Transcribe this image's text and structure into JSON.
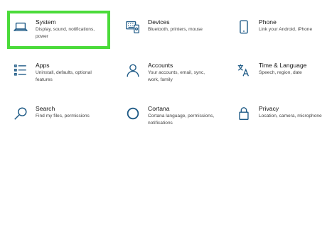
{
  "tiles": [
    {
      "icon": "laptop-icon",
      "title": "System",
      "desc": [
        "Display, sound, notifications,",
        "power"
      ]
    },
    {
      "icon": "keyboard-icon",
      "title": "Devices",
      "desc": [
        "Bluetooth, printers, mouse"
      ]
    },
    {
      "icon": "phone-icon",
      "title": "Phone",
      "desc": [
        "Link your Android, iPhone"
      ]
    },
    {
      "icon": "apps-list-icon",
      "title": "Apps",
      "desc": [
        "Uninstall, defaults, optional",
        "features"
      ]
    },
    {
      "icon": "person-icon",
      "title": "Accounts",
      "desc": [
        "Your accounts, email, sync,",
        "work, family"
      ]
    },
    {
      "icon": "language-icon",
      "title": "Time & Language",
      "desc": [
        "Speech, region, date"
      ]
    },
    {
      "icon": "search-icon",
      "title": "Search",
      "desc": [
        "Find my files, permissions"
      ]
    },
    {
      "icon": "cortana-icon",
      "title": "Cortana",
      "desc": [
        "Cortana language, permissions,",
        "notifications"
      ]
    },
    {
      "icon": "lock-icon",
      "title": "Privacy",
      "desc": [
        "Location, camera, microphone"
      ]
    }
  ],
  "colors": {
    "icon": "#1e5a86",
    "highlight": "#4bdb3a"
  }
}
